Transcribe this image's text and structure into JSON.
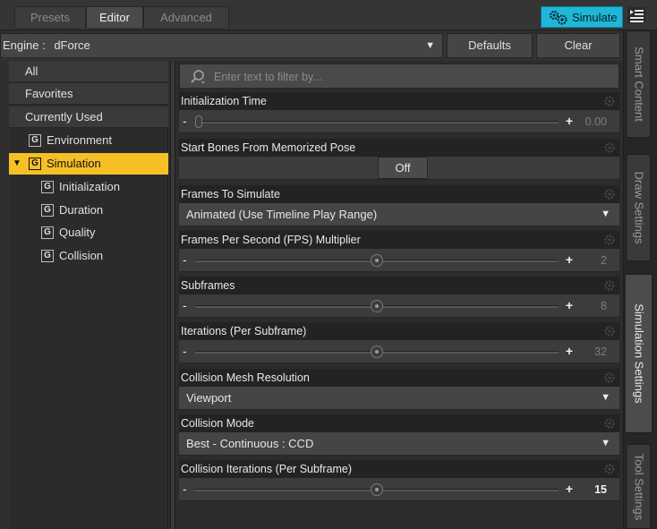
{
  "tabs": {
    "presets": "Presets",
    "editor": "Editor",
    "advanced": "Advanced",
    "active": "Editor"
  },
  "toolbar": {
    "simulate_label": "Simulate",
    "simulate_color": "#1fb7d8"
  },
  "engine": {
    "label": "Engine :",
    "value": "dForce",
    "defaults_label": "Defaults",
    "clear_label": "Clear"
  },
  "tree": {
    "all": "All",
    "favorites": "Favorites",
    "currently_used": "Currently Used",
    "environment": "Environment",
    "simulation": "Simulation",
    "initialization": "Initialization",
    "duration": "Duration",
    "quality": "Quality",
    "collision": "Collision",
    "group_badge": "G",
    "selected_color": "#f5c026"
  },
  "filter": {
    "placeholder": "Enter text to filter by..."
  },
  "properties": {
    "initialization_time": {
      "label": "Initialization Time",
      "value": "0.00",
      "level": 0.0
    },
    "start_bones": {
      "label": "Start Bones From Memorized Pose",
      "value": "Off"
    },
    "frames_to_simulate": {
      "label": "Frames To Simulate",
      "value": "Animated (Use Timeline Play Range)"
    },
    "fps_multiplier": {
      "label": "Frames Per Second (FPS) Multiplier",
      "value": "2",
      "level": 0.5
    },
    "subframes": {
      "label": "Subframes",
      "value": "8",
      "level": 0.5
    },
    "iterations": {
      "label": "Iterations (Per Subframe)",
      "value": "32",
      "level": 0.5
    },
    "collision_mesh_resolution": {
      "label": "Collision Mesh Resolution",
      "value": "Viewport"
    },
    "collision_mode": {
      "label": "Collision Mode",
      "value": "Best - Continuous : CCD"
    },
    "collision_iterations": {
      "label": "Collision Iterations (Per Subframe)",
      "value": "15",
      "level": 0.5
    }
  },
  "side_tabs": {
    "smart_content": "Smart Content",
    "draw_settings": "Draw Settings",
    "simulation_settings": "Simulation Settings",
    "tool_settings": "Tool Settings",
    "active": "Simulation Settings"
  }
}
